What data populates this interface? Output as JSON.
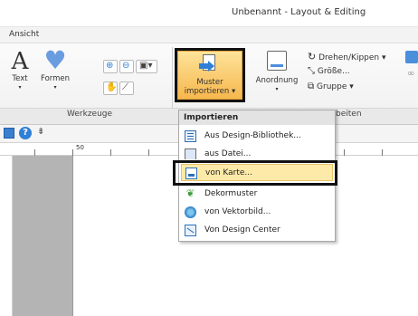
{
  "window": {
    "title": "Unbenannt - Layout & Editing"
  },
  "menu": {
    "tab": "Ansicht"
  },
  "ribbon": {
    "text_label": "Text",
    "formen_label": "Formen",
    "werkzeuge_group": "Werkzeuge",
    "muster_line1": "Muster",
    "muster_line2": "importieren",
    "anordnung_label": "Anordnung",
    "drehen_label": "Drehen/Kippen",
    "groesse_label": "Größe...",
    "gruppe_label": "Gruppe",
    "bearbeiten_group_partial": "beiten"
  },
  "ruler": {
    "mark": "50"
  },
  "dropdown": {
    "header": "Importieren",
    "items": [
      {
        "label": "Aus Design-Bibliothek...",
        "icon": "library-icon"
      },
      {
        "label": "aus Datei...",
        "icon": "file-icon"
      },
      {
        "label": "von Karte...",
        "icon": "card-icon"
      },
      {
        "label": "Dekormuster",
        "icon": "decor-pattern-icon"
      },
      {
        "label": "von Vektorbild...",
        "icon": "vector-image-icon"
      },
      {
        "label": "Von Design Center",
        "icon": "design-center-icon"
      }
    ]
  },
  "colors": {
    "highlight": "#fdeaa8",
    "accent_orange": "#f7b74d",
    "accent_blue": "#2f7fd6"
  }
}
